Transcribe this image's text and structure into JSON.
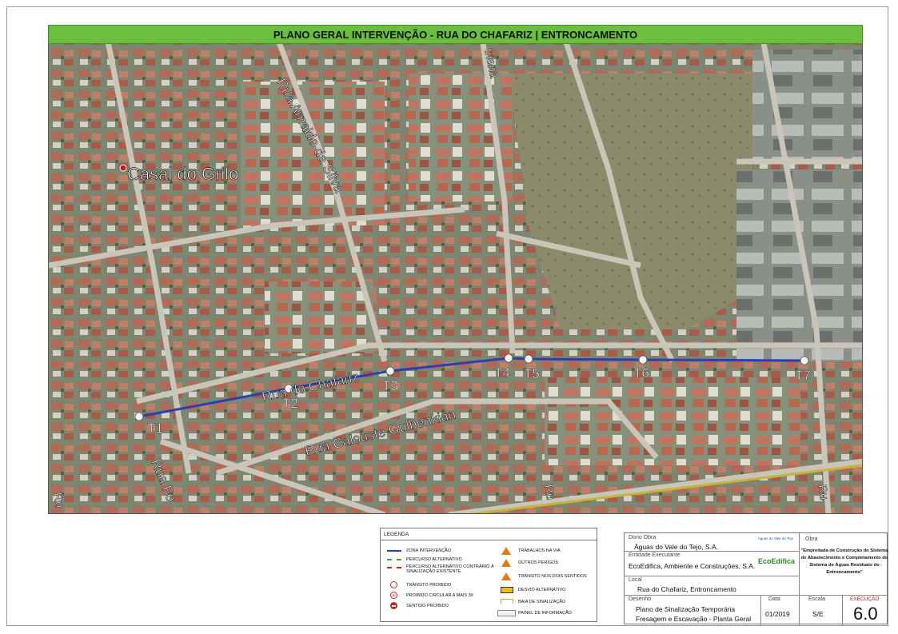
{
  "title": "PLANO GERAL INTERVENÇÃO - RUA DO CHAFARIZ | ENTRONCAMENTO",
  "map": {
    "place_label": "Casal do Grilo",
    "streets": [
      {
        "id": "arnaldo",
        "label": "Rua Arnaldo da Silva"
      },
      {
        "id": "chafariz",
        "label": "Rua do Chafariz"
      },
      {
        "id": "calouste",
        "label": "Rua Calouste Gulbenkian"
      },
      {
        "id": "fo",
        "label": "Rua Fo"
      },
      {
        "id": "top",
        "label": "triana"
      },
      {
        "id": "ru-left",
        "label": "Ru"
      },
      {
        "id": "ru-mid",
        "label": "Ru"
      },
      {
        "id": "ru-right",
        "label": "Ru"
      }
    ],
    "points": [
      {
        "label": "T1"
      },
      {
        "label": "T2"
      },
      {
        "label": "T3"
      },
      {
        "label": "T4"
      },
      {
        "label": "T5"
      },
      {
        "label": "T6"
      },
      {
        "label": "T7"
      }
    ],
    "colors": {
      "route": "#2a3fb0",
      "title_bg": "#6abf3f"
    }
  },
  "legend": {
    "title": "LEGENDA",
    "left": [
      {
        "icon": "blue-line",
        "label": "ZONA INTERVENÇÃO"
      },
      {
        "icon": "green-dash-line",
        "label": "PERCURSO ALTERNATIVO"
      },
      {
        "icon": "red-dash-line",
        "label": "PERCURSO ALTERNATIVO CONTRÁRIO À SINALIZAÇÃO EXISTENTE"
      },
      {
        "icon": "no-traffic-sign",
        "label": "TRÂNSITO PROIBIDO"
      },
      {
        "icon": "speed-limit-sign",
        "label": "PROIBIDO CIRCULAR A MAIS 30"
      },
      {
        "icon": "no-entry-sign",
        "label": "SENTIDO PROIBIDO"
      }
    ],
    "right": [
      {
        "icon": "roadworks-sign",
        "label": "TRABALHOS NA VIA"
      },
      {
        "icon": "danger-sign",
        "label": "OUTROS PERIGOS"
      },
      {
        "icon": "two-way-sign",
        "label": "TRÂNSITO NOS DOIS SENTIDOS"
      },
      {
        "icon": "detour-sign",
        "label": "DESVIO ALTERNATIVO"
      },
      {
        "icon": "barrier-sign",
        "label": "BAIA DE SINALIZAÇÃO"
      },
      {
        "icon": "info-panel",
        "label": "PAINEL DE INFORMAÇÃO"
      }
    ],
    "speed_value": "30"
  },
  "title_block": {
    "dono_label": "Dono Obra",
    "dono_value": "Águas do Vale do Tejo, S.A.",
    "dono_logo": "Águas do Vale do Tejo",
    "entidade_label": "Entidade Executante",
    "entidade_value": "EcoEdifica, Ambiente e Construções, S.A.",
    "entidade_logo": "EcoEdifica",
    "local_label": "Local",
    "local_value": "Rua do Chafariz, Entroncamento",
    "obra_label": "Obra",
    "obra_value": "\"Empreitada de Construção do Sistema de Abastecimento e Completamento do Sistema de Águas Residuais do Entroncamento\"",
    "desenho_label": "Desenho",
    "desenho_line1": "Plano de Sinalização Temporária",
    "desenho_line2": "Fresagem e Escavação - Planta Geral",
    "data_label": "Data",
    "data_value": "01/2019",
    "escala_label": "Escala",
    "escala_value": "S/E",
    "execucao_label": "EXECUÇÃO",
    "execucao_value": "6.0"
  }
}
